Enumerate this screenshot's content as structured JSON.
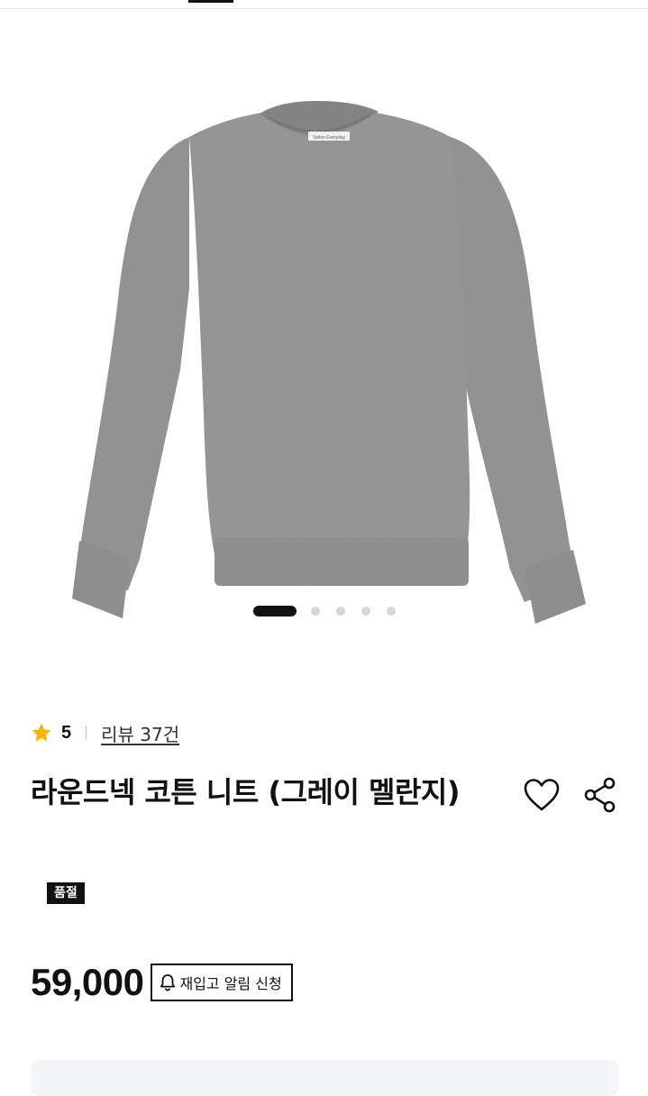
{
  "product": {
    "rating": "5",
    "reviews_label": "리뷰 37건",
    "title": "라운드넥 코튼 니트 (그레이 멜란지)",
    "badge": "품절",
    "price": "59,000",
    "restock_label": "재입고 알림 신청",
    "garment_label": "Yahoo Everyday"
  },
  "gallery": {
    "image_count": 5,
    "active_index": 0,
    "garment_color": "#8f8f8f"
  },
  "colors": {
    "star": "#f4b400",
    "text": "#111111",
    "inactive_dot": "#d6d6d6",
    "panel": "#f4f5f7"
  },
  "icons": [
    "star-icon",
    "heart-icon",
    "share-icon",
    "bell-icon"
  ]
}
